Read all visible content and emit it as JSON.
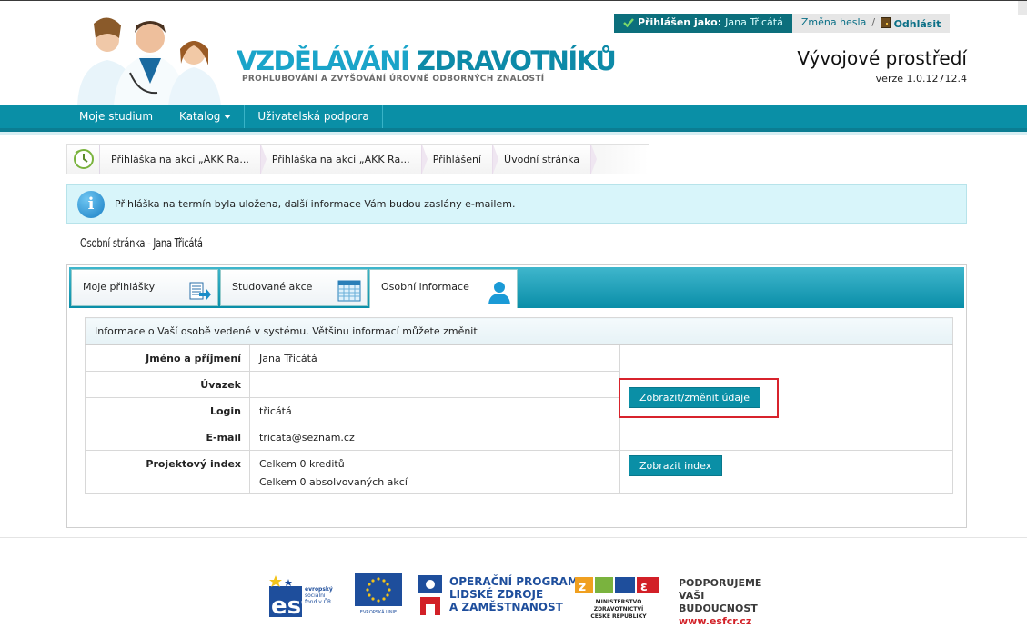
{
  "header": {
    "logged_label": "Přihlášen jako:",
    "user_name": "Jana Třicátá",
    "change_password": "Změna hesla",
    "separator": "/",
    "logout": "Odhlásit",
    "logo_part1": "VZDĚLÁVÁNÍ ",
    "logo_part2": "ZDRAVOTNÍKŮ",
    "logo_subtitle": "PROHLUBOVÁNÍ A ZVYŠOVÁNÍ ÚROVNĚ ODBORNÝCH ZNALOSTÍ",
    "environment": "Vývojové prostředí",
    "version": "verze 1.0.12712.4"
  },
  "nav": {
    "items": [
      {
        "label": "Moje studium"
      },
      {
        "label": "Katalog"
      },
      {
        "label": "Uživatelská podpora"
      }
    ]
  },
  "breadcrumb": {
    "items": [
      "Přihláška na akci „AKK Ra...",
      "Přihláška na akci „AKK Ra...",
      "Přihlášení",
      "Úvodní stránka"
    ]
  },
  "notice": {
    "text": "Přihláška na termín byla uložena, další informace Vám budou zaslány e-mailem."
  },
  "page": {
    "heading": "Osobní stránka - Jana Třicátá"
  },
  "tabs": [
    {
      "label": "Moje přihlášky"
    },
    {
      "label": "Studované akce"
    },
    {
      "label": "Osobní informace"
    }
  ],
  "info_table": {
    "caption": "Informace o Vaší osobě vedené v systému. Většinu informací můžete změnit",
    "rows": [
      {
        "label": "Jméno a příjmení",
        "value": "Jana Třicátá"
      },
      {
        "label": "Úvazek",
        "value": ""
      },
      {
        "label": "Login",
        "value": "třicátá"
      },
      {
        "label": "E-mail",
        "value": "tricata@seznam.cz"
      }
    ],
    "project_index_label": "Projektový index",
    "project_index_line1": "Celkem 0 kreditů",
    "project_index_line2": "Celkem 0 absolvovaných akcí",
    "edit_button": "Zobrazit/změnit údaje",
    "index_button": "Zobrazit index"
  },
  "footer": {
    "esf_line1": "evropský",
    "esf_line2": "sociální",
    "esf_line3": "fond v ČR",
    "eu_label": "EVROPSKÁ UNIE",
    "op_line1": "OPERAČNÍ PROGRAM",
    "op_line2": "LIDSKÉ ZDROJE",
    "op_line3": "A ZAMĚSTNANOST",
    "mz_line1": "MINISTERSTVO ZDRAVOTNICTVÍ",
    "mz_line2": "ČESKÉ REPUBLIKY",
    "podp_line1": "PODPORUJEME",
    "podp_line2": "VAŠI BUDOUCNOST",
    "podp_url": "www.esfcr.cz"
  },
  "colors": {
    "accent": "#0a8fa6",
    "highlight": "#d8232c"
  }
}
